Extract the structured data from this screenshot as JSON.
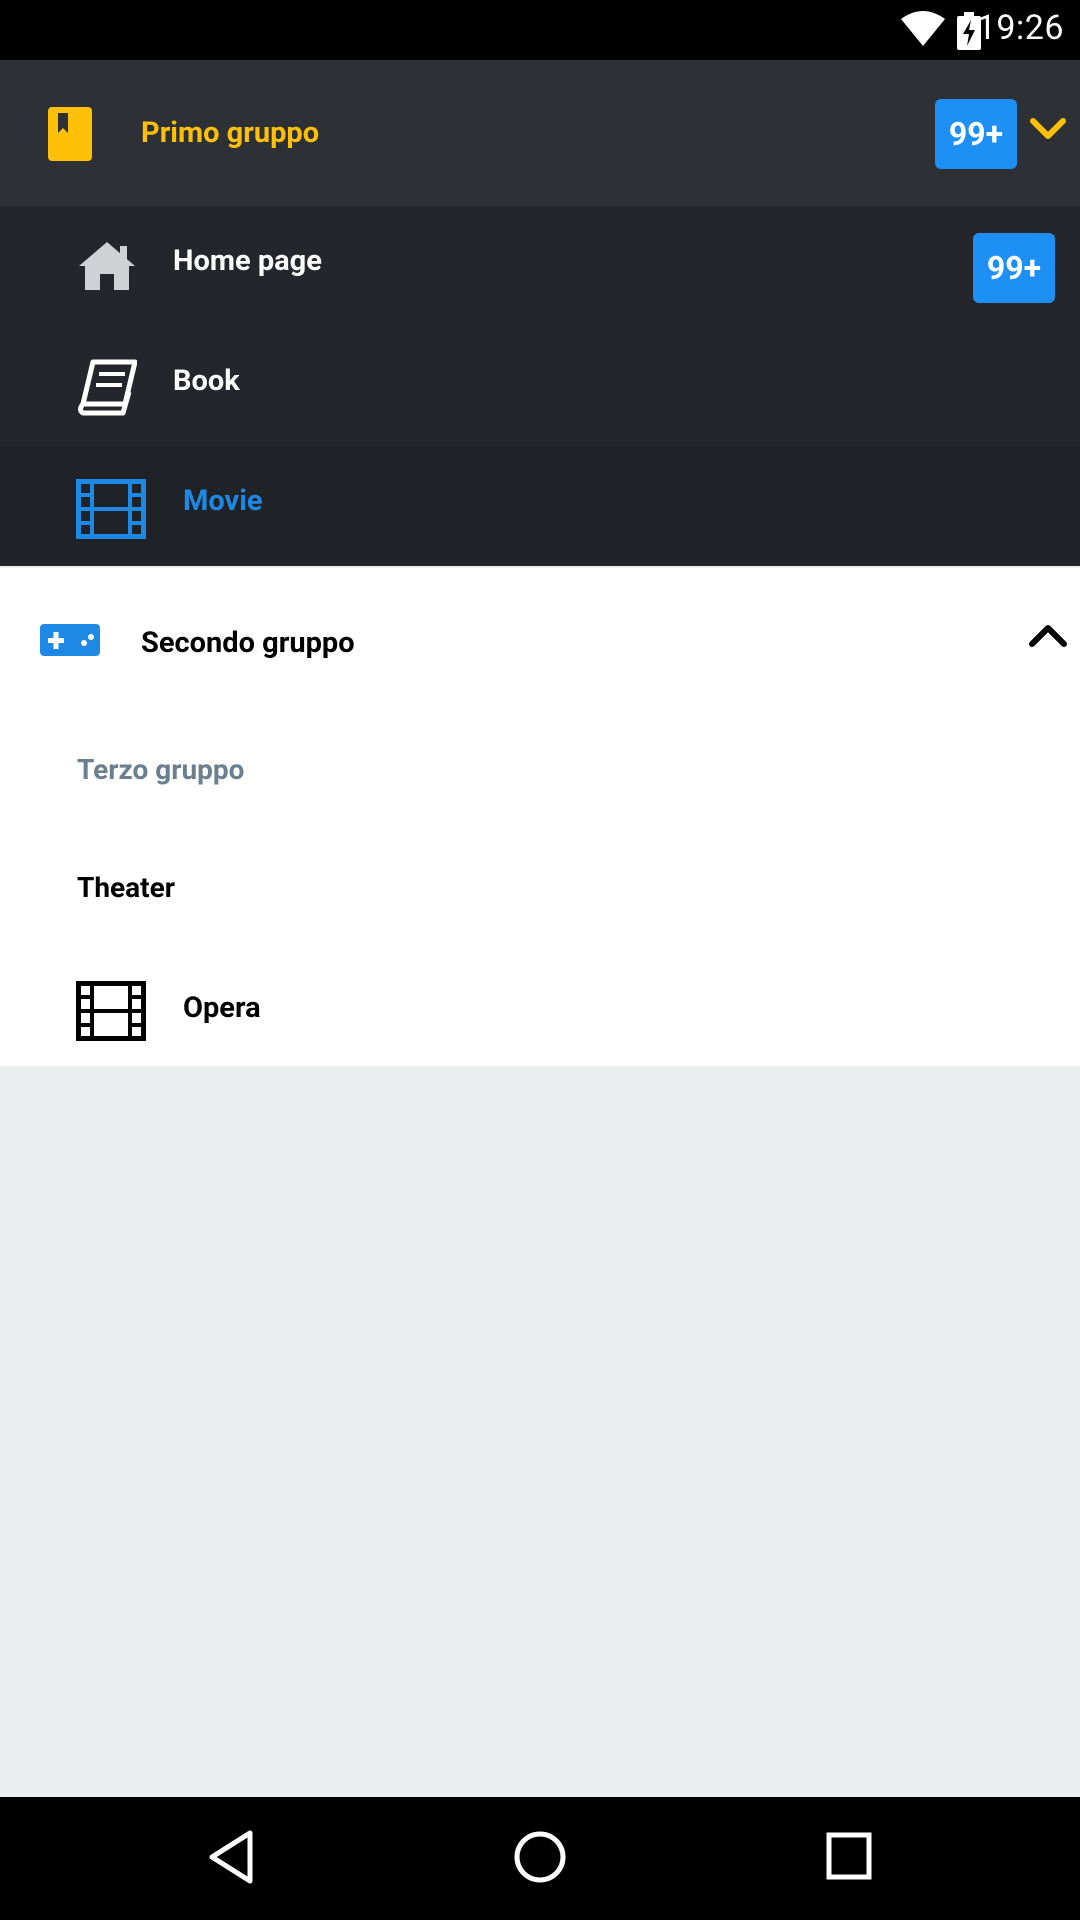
{
  "status_bar": {
    "time": "19:26",
    "icons": [
      "wifi-icon",
      "battery-charging-icon"
    ]
  },
  "drawer": {
    "group1": {
      "title": "Primo gruppo",
      "badge": "99+",
      "icon": "bookmark-icon",
      "expand_icon": "chevron-down-icon",
      "accent_color": "#ffc107",
      "items": [
        {
          "label": "Home page",
          "icon": "home-icon",
          "badge": "99+"
        },
        {
          "label": "Book",
          "icon": "book-icon"
        },
        {
          "label": "Movie",
          "icon": "film-icon",
          "selected": true
        }
      ]
    },
    "group2": {
      "title": "Secondo gruppo",
      "icon": "gamepad-icon",
      "collapse_icon": "chevron-up-icon",
      "subgroup_title": "Terzo gruppo",
      "items": [
        {
          "label": "Theater"
        },
        {
          "label": "Opera",
          "icon": "film-icon"
        }
      ]
    }
  },
  "colors": {
    "badge": "#1e90f5",
    "selected": "#1e88e5",
    "header_bg": "#2d3035",
    "item_bg": "#24262c"
  },
  "nav_bar": {
    "icons": [
      "back-icon",
      "home-circle-icon",
      "recents-icon"
    ]
  }
}
